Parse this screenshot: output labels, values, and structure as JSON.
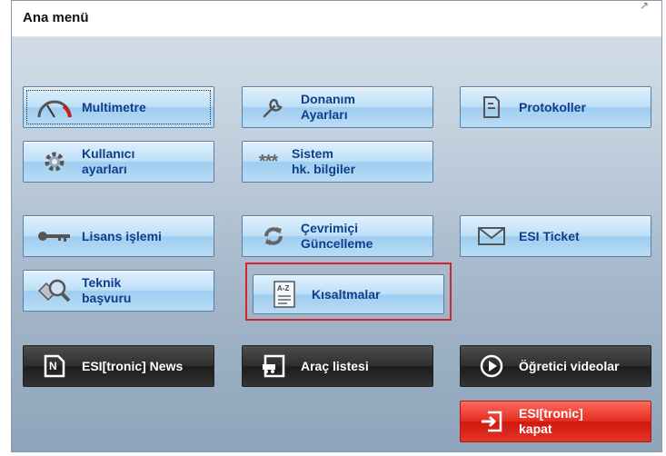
{
  "window": {
    "title": "Ana menü"
  },
  "buttons": {
    "multimetre": "Multimetre",
    "donanim": "Donanım\nAyarları",
    "protokoller": "Protokoller",
    "kullanici": "Kullanıcı\nayarları",
    "sistem": "Sistem\nhk. bilgiler",
    "lisans": "Lisans işlemi",
    "cevrimici": "Çevrimiçi\nGüncelleme",
    "esi_ticket": "ESI Ticket",
    "teknik": "Teknik\nbaşvuru",
    "kisaltmalar": "Kısaltmalar",
    "news": "ESI[tronic] News",
    "arac": "Araç listesi",
    "ogretici": "Öğretici videolar",
    "kapat": "ESI[tronic]\nkapat"
  },
  "icons": {
    "multimetre": "gauge-icon",
    "donanim": "wrench-icon",
    "protokoller": "document-icon",
    "kullanici": "gear-icon",
    "sistem": "asterisks-icon",
    "lisans": "key-icon",
    "cevrimici": "refresh-icon",
    "esi_ticket": "envelope-icon",
    "teknik": "magnifier-icon",
    "kisaltmalar": "az-document-icon",
    "news": "news-icon",
    "arac": "car-list-icon",
    "ogretici": "play-icon",
    "kapat": "exit-icon"
  },
  "colors": {
    "blue_text": "#0e3e8c",
    "highlight": "#d22530",
    "close": "#e42a1f"
  }
}
